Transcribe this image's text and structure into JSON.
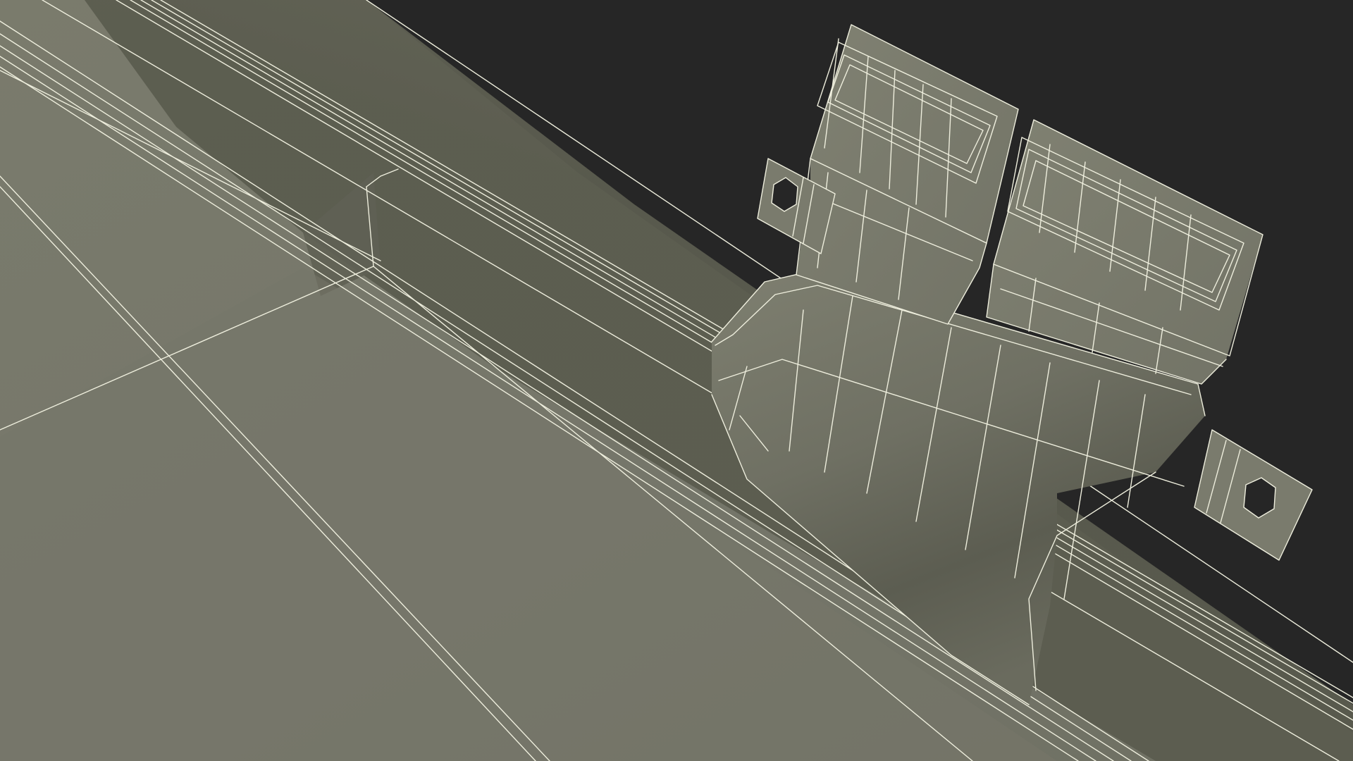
{
  "scene": {
    "kind": "3d-wireframe-render",
    "subject": "hinge-on-panel",
    "background_color": "#262626",
    "surface_color": "#777869",
    "surface_shadow_color": "#5e5f52",
    "wire_color": "#eeeedd"
  }
}
